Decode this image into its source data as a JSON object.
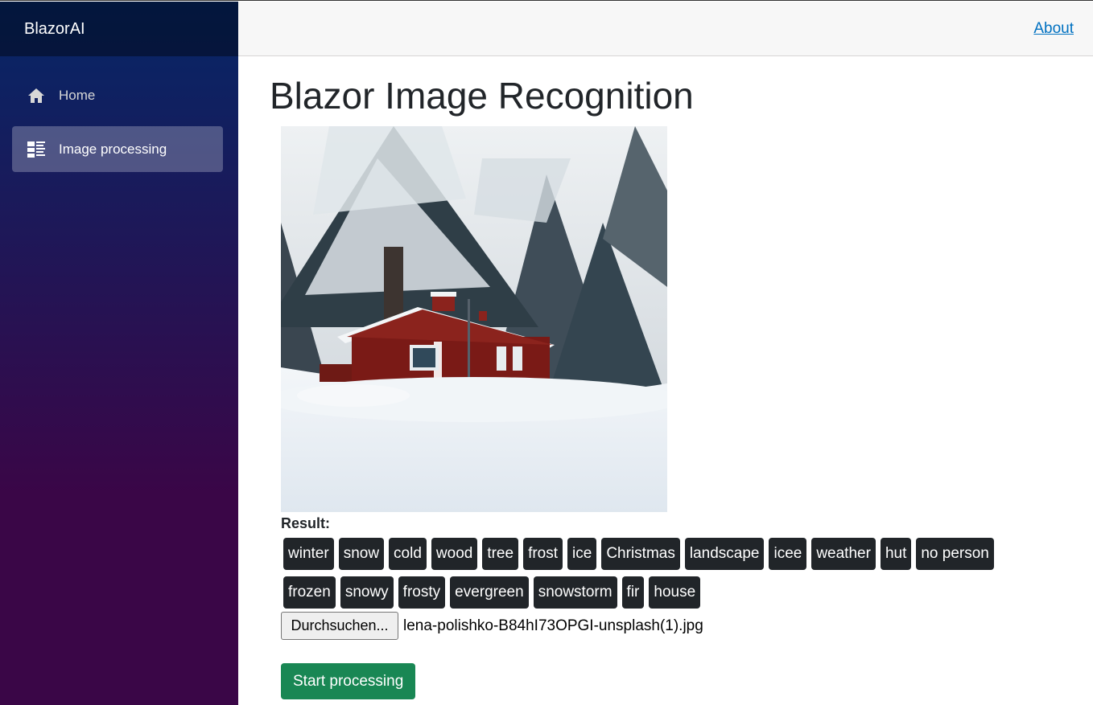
{
  "brand": "BlazorAI",
  "nav": {
    "items": [
      {
        "label": "Home",
        "icon": "home-icon",
        "active": false
      },
      {
        "label": "Image processing",
        "icon": "list-rich-icon",
        "active": true
      }
    ]
  },
  "topbar": {
    "about_label": "About"
  },
  "main": {
    "title": "Blazor Image Recognition",
    "result_label": "Result:",
    "tags": [
      "winter",
      "snow",
      "cold",
      "wood",
      "tree",
      "frost",
      "ice",
      "Christmas",
      "landscape",
      "icee",
      "weather",
      "hut",
      "no person",
      "frozen",
      "snowy",
      "frosty",
      "evergreen",
      "snowstorm",
      "fir",
      "house"
    ],
    "file_button_label": "Durchsuchen...",
    "file_name": "lena-polishko-B84hI73OPGI-unsplash(1).jpg",
    "start_button_label": "Start processing"
  },
  "colors": {
    "sidebar_top": "#052767",
    "sidebar_bottom": "#3a0647",
    "start_button": "#198754",
    "tag_background": "#212529",
    "link": "#0071c1"
  }
}
